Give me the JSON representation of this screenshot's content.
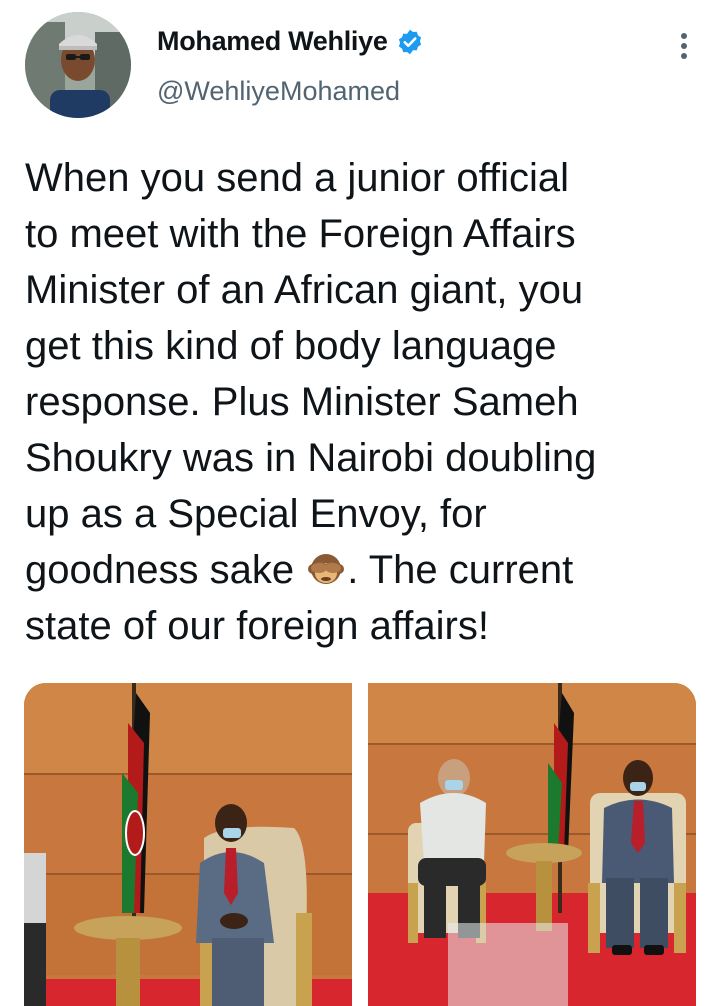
{
  "author": {
    "name": "Mohamed Wehliye",
    "handle": "@WehliyeMohamed"
  },
  "tweet": {
    "lines": [
      "When you send a junior official",
      "to meet with the Foreign Affairs",
      "Minister of an African giant, you",
      "get this kind of body language",
      "response. Plus Minister Sameh",
      "Shoukry was in Nairobi doubling",
      "up as a Special Envoy, for",
      "goodness sake",
      ". The current",
      "state of our foreign affairs!"
    ],
    "emoji": "see-no-evil-monkey"
  },
  "colors": {
    "text": "#0f1419",
    "secondary": "#536471",
    "verified": "#1d9bf0",
    "wood": "#c8783e",
    "carpet": "#d7262e"
  }
}
